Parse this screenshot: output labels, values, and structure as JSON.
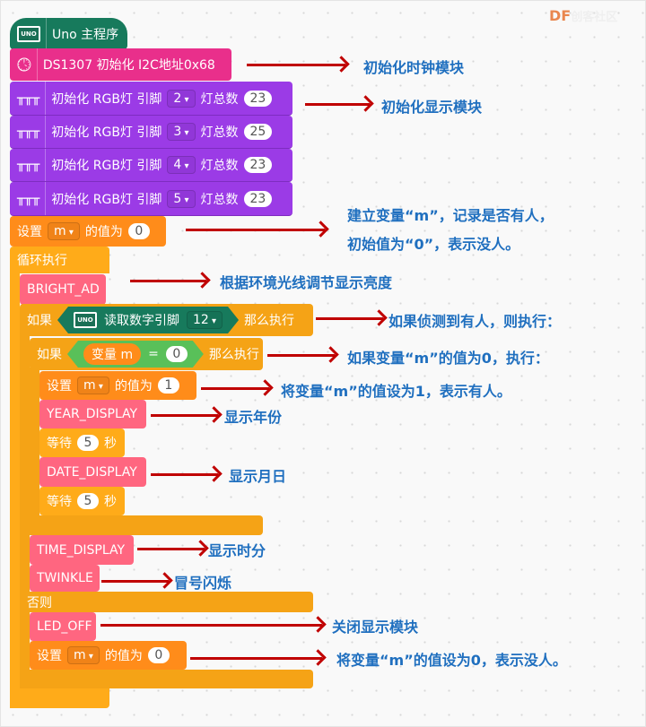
{
  "watermark": {
    "brand": "DF",
    "text": "创客社区",
    "url": "mc.DFRobot.com.cn"
  },
  "blocks": {
    "main": "Uno 主程序",
    "uno_icon": "UNO",
    "ds1307": "DS1307 初始化 I2C地址0x68",
    "rgb": [
      {
        "label": "初始化 RGB灯 引脚",
        "pin": "2",
        "count_label": "灯总数",
        "count": "23"
      },
      {
        "label": "初始化 RGB灯 引脚",
        "pin": "3",
        "count_label": "灯总数",
        "count": "25"
      },
      {
        "label": "初始化 RGB灯 引脚",
        "pin": "4",
        "count_label": "灯总数",
        "count": "23"
      },
      {
        "label": "初始化 RGB灯 引脚",
        "pin": "5",
        "count_label": "灯总数",
        "count": "23"
      }
    ],
    "set_label": "设置",
    "var": "m",
    "value_label": "的值为",
    "init_value": "0",
    "loop": "循环执行",
    "bright": "BRIGHT_AD",
    "if": "如果",
    "then": "那么执行",
    "else": "否则",
    "read_pin": "读取数字引脚",
    "read_pin_value": "12",
    "var_label": "变量 m",
    "eq": "=",
    "cmp_value": "0",
    "set_value_1": "1",
    "year": "YEAR_DISPLAY",
    "wait": "等待",
    "wait_value": "5",
    "sec": "秒",
    "date": "DATE_DISPLAY",
    "time": "TIME_DISPLAY",
    "twinkle": "TWINKLE",
    "led_off": "LED_OFF",
    "set_value_0": "0"
  },
  "notes": [
    "初始化时钟模块",
    "初始化显示模块",
    "建立变量“m”，记录是否有人，",
    "初始值为“0”，表示没人。",
    "根据环境光线调节显示亮度",
    "如果侦测到有人，则执行：",
    "如果变量“m”的值为0，执行：",
    "将变量“m”的值设为1，表示有人。",
    "显示年份",
    "显示月日",
    "显示时分",
    "冒号闪烁",
    "关闭显示模块",
    "将变量“m”的值设为0，表示没人。"
  ],
  "colors": {
    "arrow": "#c00000",
    "note": "#1f6fbf",
    "event": "#177a5c",
    "rtc": "#e92f8b",
    "rgb": "#9b3be6",
    "variable": "#ff8c1a",
    "control": "#ffab19",
    "function": "#ff6680"
  }
}
